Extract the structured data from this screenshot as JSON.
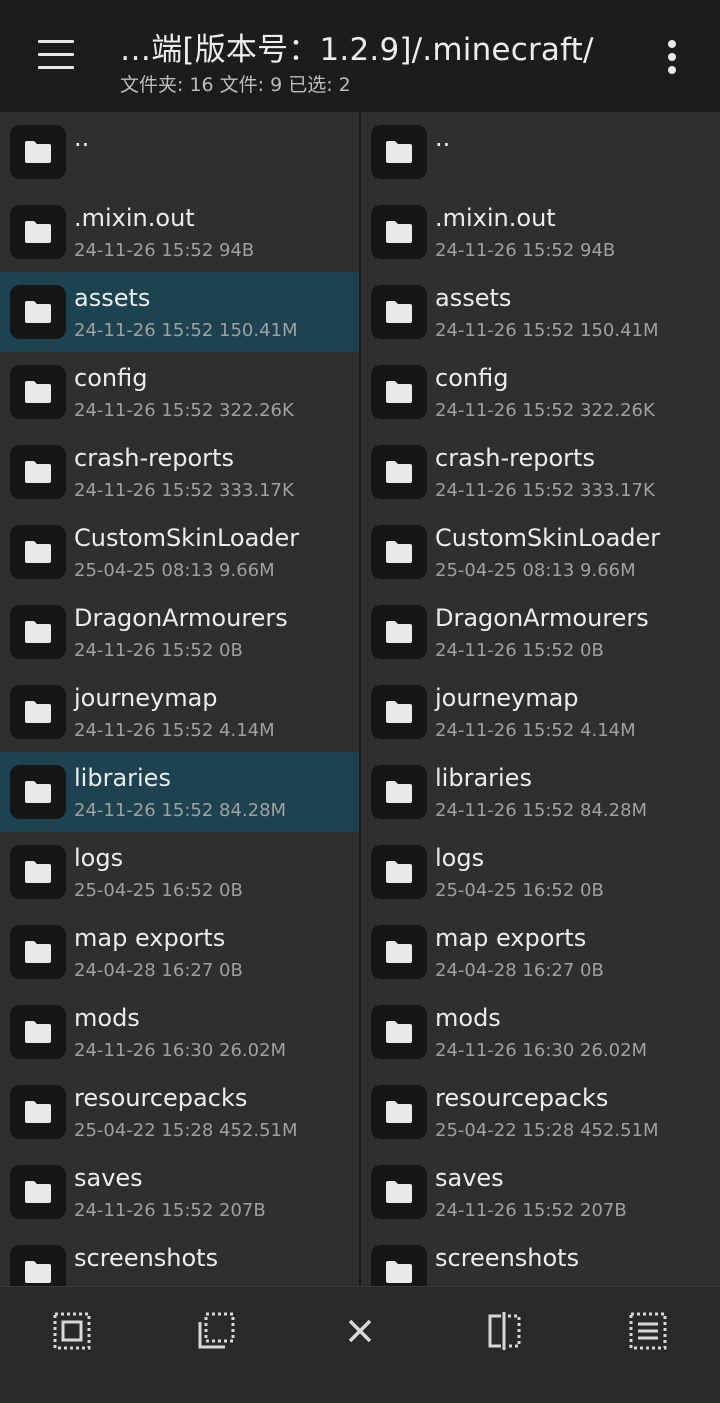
{
  "header": {
    "title": "…端[版本号：1.2.9]/.minecraft/",
    "subtitle": "文件夹: 16  文件: 9  已选: 2"
  },
  "left_pane": {
    "items": [
      {
        "name": "..",
        "meta": "",
        "selected": false
      },
      {
        "name": ".mixin.out",
        "meta": "24-11-26 15:52  94B",
        "selected": false
      },
      {
        "name": "assets",
        "meta": "24-11-26 15:52  150.41M",
        "selected": true
      },
      {
        "name": "config",
        "meta": "24-11-26 15:52  322.26K",
        "selected": false
      },
      {
        "name": "crash-reports",
        "meta": "24-11-26 15:52  333.17K",
        "selected": false
      },
      {
        "name": "CustomSkinLoader",
        "meta": "25-04-25 08:13  9.66M",
        "selected": false
      },
      {
        "name": "DragonArmourers",
        "meta": "24-11-26 15:52  0B",
        "selected": false
      },
      {
        "name": "journeymap",
        "meta": "24-11-26 15:52  4.14M",
        "selected": false
      },
      {
        "name": "libraries",
        "meta": "24-11-26 15:52  84.28M",
        "selected": true
      },
      {
        "name": "logs",
        "meta": "25-04-25 16:52  0B",
        "selected": false
      },
      {
        "name": "map exports",
        "meta": "24-04-28 16:27  0B",
        "selected": false
      },
      {
        "name": "mods",
        "meta": "24-11-26 16:30  26.02M",
        "selected": false
      },
      {
        "name": "resourcepacks",
        "meta": "25-04-22 15:28  452.51M",
        "selected": false
      },
      {
        "name": "saves",
        "meta": "24-11-26 15:52  207B",
        "selected": false
      },
      {
        "name": "screenshots",
        "meta": "",
        "selected": false
      }
    ]
  },
  "right_pane": {
    "items": [
      {
        "name": "..",
        "meta": ""
      },
      {
        "name": ".mixin.out",
        "meta": "24-11-26 15:52  94B"
      },
      {
        "name": "assets",
        "meta": "24-11-26 15:52  150.41M"
      },
      {
        "name": "config",
        "meta": "24-11-26 15:52  322.26K"
      },
      {
        "name": "crash-reports",
        "meta": "24-11-26 15:52  333.17K"
      },
      {
        "name": "CustomSkinLoader",
        "meta": "25-04-25 08:13  9.66M"
      },
      {
        "name": "DragonArmourers",
        "meta": "24-11-26 15:52  0B"
      },
      {
        "name": "journeymap",
        "meta": "24-11-26 15:52  4.14M"
      },
      {
        "name": "libraries",
        "meta": "24-11-26 15:52  84.28M"
      },
      {
        "name": "logs",
        "meta": "25-04-25 16:52  0B"
      },
      {
        "name": "map exports",
        "meta": "24-04-28 16:27  0B"
      },
      {
        "name": "mods",
        "meta": "24-11-26 16:30  26.02M"
      },
      {
        "name": "resourcepacks",
        "meta": "25-04-22 15:28  452.51M"
      },
      {
        "name": "saves",
        "meta": "24-11-26 15:52  207B"
      },
      {
        "name": "screenshots",
        "meta": ""
      }
    ]
  },
  "bottom_bar": {
    "buttons": [
      "select-all-icon",
      "select-region-icon",
      "close-icon",
      "split-view-icon",
      "list-select-icon"
    ]
  },
  "colors": {
    "background": "#2c2c2c",
    "topbar": "#1c1c1c",
    "selected_row": "#1d4350",
    "folder_tile": "#161616"
  }
}
